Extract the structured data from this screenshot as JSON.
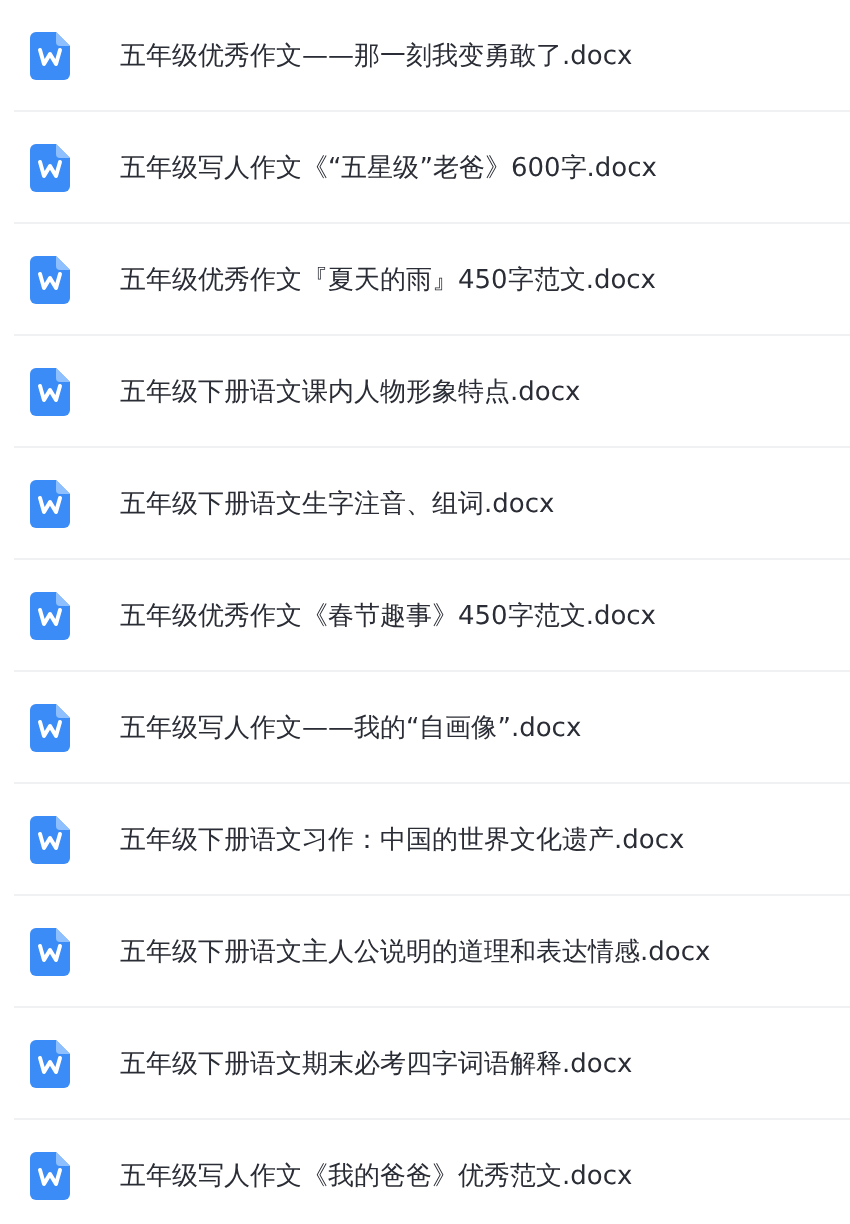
{
  "files": [
    {
      "name": "五年级优秀作文——那一刻我变勇敢了.docx"
    },
    {
      "name": "五年级写人作文《“五星级”老爸》600字.docx"
    },
    {
      "name": "五年级优秀作文『夏天的雨』450字范文.docx"
    },
    {
      "name": "五年级下册语文课内人物形象特点.docx"
    },
    {
      "name": "五年级下册语文生字注音、组词.docx"
    },
    {
      "name": "五年级优秀作文《春节趣事》450字范文.docx"
    },
    {
      "name": "五年级写人作文——我的“自画像”.docx"
    },
    {
      "name": "五年级下册语文习作：中国的世界文化遗产.docx"
    },
    {
      "name": "五年级下册语文主人公说明的道理和表达情感.docx"
    },
    {
      "name": "五年级下册语文期末必考四字词语解释.docx"
    },
    {
      "name": "五年级写人作文《我的爸爸》优秀范文.docx"
    }
  ]
}
